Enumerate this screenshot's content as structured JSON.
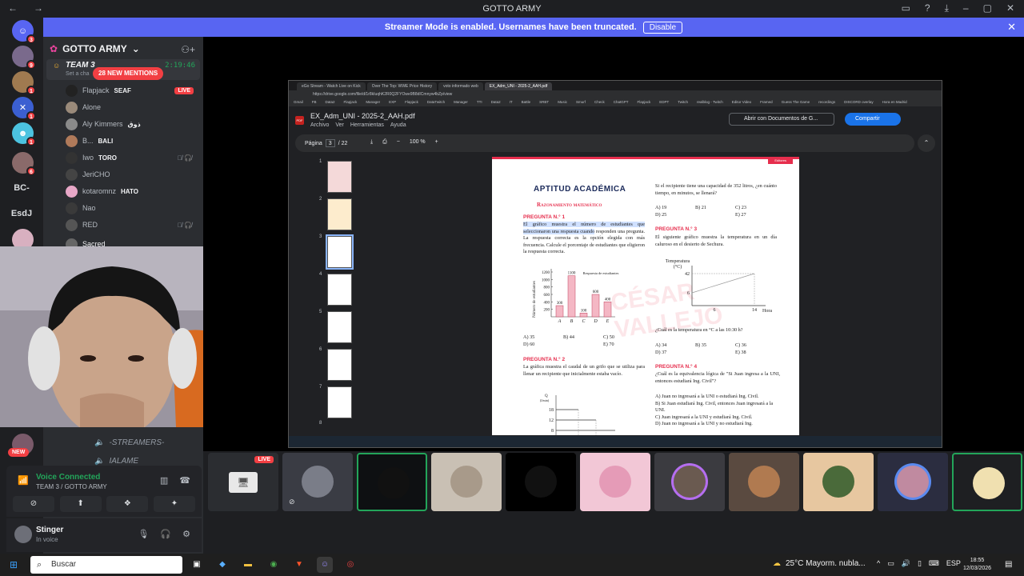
{
  "window": {
    "title": "GOTTO ARMY"
  },
  "banner": {
    "text": "Streamer Mode is enabled. Usernames have been truncated.",
    "button": "Disable"
  },
  "servers": [
    {
      "badge": "3",
      "color": "#5865f2",
      "icon": "discord-icon"
    },
    {
      "badge": "9",
      "color": "#7a6a8c",
      "icon": "avatar"
    },
    {
      "badge": "1",
      "color": "#a07a50",
      "icon": "avatar"
    },
    {
      "badge": "1",
      "color": "#3b5fd1",
      "icon": "avatar"
    },
    {
      "badge": "1",
      "color": "#4cc3e0",
      "icon": "avatar"
    },
    {
      "badge": "6",
      "color": "#8a6a6a",
      "icon": "avatar"
    }
  ],
  "server_labels": [
    "BC-",
    "EsdJ"
  ],
  "sidebar": {
    "server_name": "GOTTO ARMY",
    "channel": {
      "name": "TEAM 3",
      "time": "2:19:46",
      "sub": "Set a cha"
    },
    "mentions": "28 NEW MENTIONS",
    "users": [
      {
        "name": "Flapjack",
        "tag": "SEAF",
        "live": "LIVE"
      },
      {
        "name": "Alone",
        "tag": ""
      },
      {
        "name": "Aly Kimmers",
        "tag": "ذوق"
      },
      {
        "name": "B...",
        "tag": "BALI"
      },
      {
        "name": "Iwo",
        "tag": "TORO"
      },
      {
        "name": "JeriCHO",
        "tag": ""
      },
      {
        "name": "kotaromnz",
        "tag": "HATO"
      },
      {
        "name": "Nao",
        "tag": ""
      },
      {
        "name": "RED",
        "tag": ""
      },
      {
        "name": "Sacred",
        "tag": ""
      }
    ],
    "channels_below": [
      "-STREAMERS-",
      "IALAME"
    ],
    "new_badge": "NEW"
  },
  "voice": {
    "status": "Voice Connected",
    "channel": "TEAM 3 / GOTTO ARMY"
  },
  "user": {
    "name": "Stinger",
    "status": "In voice"
  },
  "browser": {
    "tabs": [
      "eGo Stream - Watch Live on Kick",
      "Over The Top: WWE Price History",
      "voto informado web",
      "EX_Adm_UNI - 2025-2_AAH.pdf"
    ],
    "url": "https://drive.google.com/file/d/1r8kIuqhK2R0Q2FYOwe9B8dICmnyw4bZp/view",
    "bookmarks": [
      "Gmail",
      "FB",
      "Data2",
      "Flapjack",
      "Manager",
      "EXP",
      "Flapjack",
      "DataTwitch",
      "Manager",
      "TTI",
      "Data2",
      "IT",
      "Battle",
      "SRBT",
      "Music",
      "Smurf",
      "Check",
      "ChatGPT",
      "Flapjack",
      "EDPT",
      "Twitch",
      "realblog - Twitch",
      "Editor Video",
      "Framed",
      "Guess The Game",
      "recordings",
      "DISCORD overlay",
      "Hora en Madrid"
    ],
    "pdf_name": "EX_Adm_UNI - 2025-2_AAH.pdf",
    "menus": [
      "Archivo",
      "Ver",
      "Herramientas",
      "Ayuda"
    ],
    "open_with": "Abrir con Documentos de G...",
    "share": "Compartir",
    "page_label": "Página",
    "page_current": "3",
    "page_total": "/ 22",
    "zoom": "100 %",
    "thumb_numbers": [
      "1",
      "2",
      "3",
      "4",
      "5",
      "6",
      "7",
      "8"
    ]
  },
  "pdf": {
    "header_label": "Editores",
    "title": "APTITUD ACADÉMICA",
    "subtitle": "Razonamiento matemático",
    "q1_title": "PREGUNTA N.° 1",
    "q1_text_hl": "El gráfico muestra el número de estudiantes que seleccionaron una respuesta cuando",
    "q1_text": " responden una pregunta. La respuesta correcta es la opción elegida con más frecuencia. Calcule el porcentaje de estudiantes que eligieron la respuesta correcta.",
    "q1_opts": [
      "A) 35",
      "B) 44",
      "C) 50",
      "D) 60",
      "E) 70"
    ],
    "q2_title": "PREGUNTA N.° 2",
    "q2_text": "La gráfica muestra el caudal de un grifo que se utiliza para llenar un recipiente que inicialmente estaba vacío.",
    "q2_side": "Si el recipiente tiene una capacidad de 352 litros, ¿en cuánto tiempo, en minutos, se llenará?",
    "q2_opts": [
      "A) 19",
      "B) 21",
      "C) 23",
      "D) 25",
      "E) 27"
    ],
    "q3_title": "PREGUNTA N.° 3",
    "q3_text": "El siguiente gráfico muestra la temperatura en un día caluroso en el desierto de Sechura.",
    "q3_question": "¿Cuál es la temperatura en °C a las 10:30 h?",
    "q3_opts": [
      "A) 34",
      "B) 35",
      "C) 36",
      "D) 37",
      "E) 38"
    ],
    "q4_title": "PREGUNTA N.° 4",
    "q4_text": "¿Cuál es la equivalencia lógica de \"Si Juan ingresa a la UNI, entonces estudiará Ing. Civil\"?",
    "q4_opts": [
      "A) Juan no ingresará a la UNI o estudiará Ing. Civil.",
      "B) Si Juan estudiará Ing. Civil, entonces Juan ingresará a la UNI.",
      "C) Juan ingresará a la UNI y estudiará Ing. Civil.",
      "D) Juan no ingresará a la UNI y no estudiará Ing."
    ],
    "bar_chart": {
      "ylabel": "Número de estudiantes",
      "legend": "Respuesta de estudiantes",
      "categories": [
        "A",
        "B",
        "C",
        "D",
        "E"
      ],
      "values": [
        300,
        1100,
        100,
        600,
        400
      ],
      "yticks": [
        "1200",
        "1000",
        "800",
        "600",
        "400",
        "200"
      ]
    },
    "temp_chart": {
      "ylabel": "Temperatura",
      "unit": "(°C)",
      "xlabel": "Hora",
      "y_ticks": [
        "42",
        "6"
      ],
      "x_ticks": [
        "6",
        "14"
      ]
    },
    "flow_chart": {
      "ylabel": "Q",
      "unit": "(l/min)",
      "y_ticks": [
        "18",
        "12",
        "8"
      ]
    },
    "watermark": "CÉSAR VALLEJO"
  },
  "stage": {
    "live": "LIVE"
  },
  "taskbar": {
    "search": "Buscar",
    "weather": "25°C  Mayorm. nubla...",
    "lang": "ESP",
    "time": "18:55",
    "date": "12/03/2026"
  }
}
